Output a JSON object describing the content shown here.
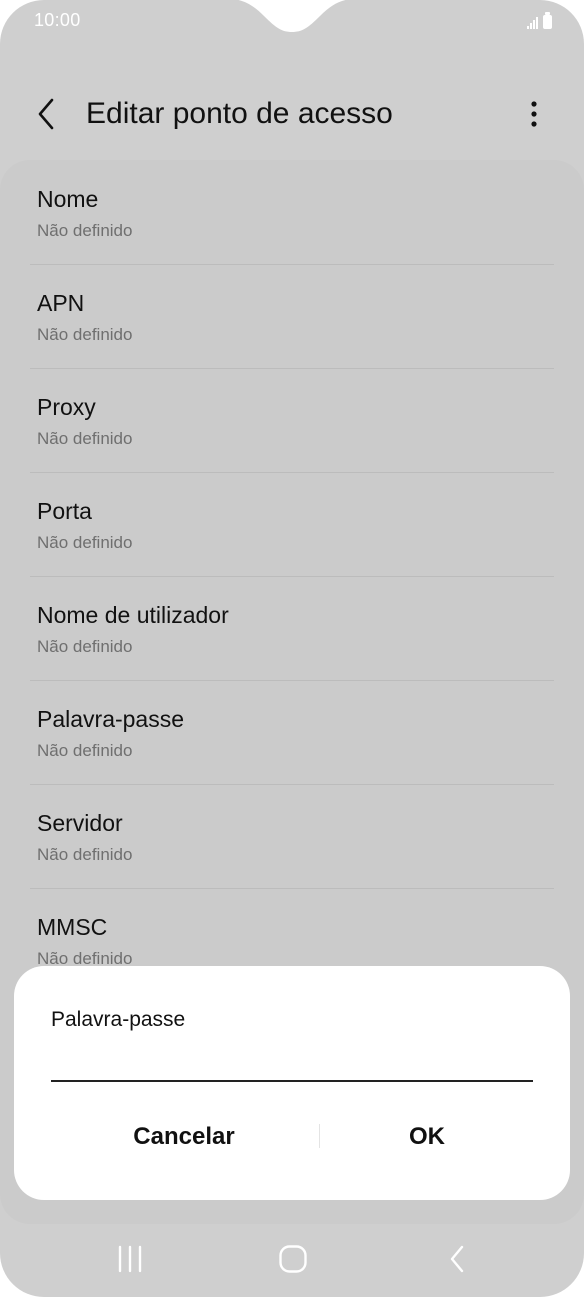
{
  "status_bar": {
    "time": "10:00"
  },
  "header": {
    "title": "Editar ponto de acesso"
  },
  "settings": [
    {
      "label": "Nome",
      "value": "Não definido"
    },
    {
      "label": "APN",
      "value": "Não definido"
    },
    {
      "label": "Proxy",
      "value": "Não definido"
    },
    {
      "label": "Porta",
      "value": "Não definido"
    },
    {
      "label": "Nome de utilizador",
      "value": "Não definido"
    },
    {
      "label": "Palavra-passe",
      "value": "Não definido"
    },
    {
      "label": "Servidor",
      "value": "Não definido"
    },
    {
      "label": "MMSC",
      "value": "Não definido"
    }
  ],
  "dialog": {
    "title": "Palavra-passe",
    "input_value": "",
    "cancel_label": "Cancelar",
    "ok_label": "OK"
  },
  "colors": {
    "dimmed_background": "#cfcfcf",
    "dialog_background": "#ffffff",
    "text_primary": "#111111",
    "text_secondary": "#6f6f6f"
  }
}
